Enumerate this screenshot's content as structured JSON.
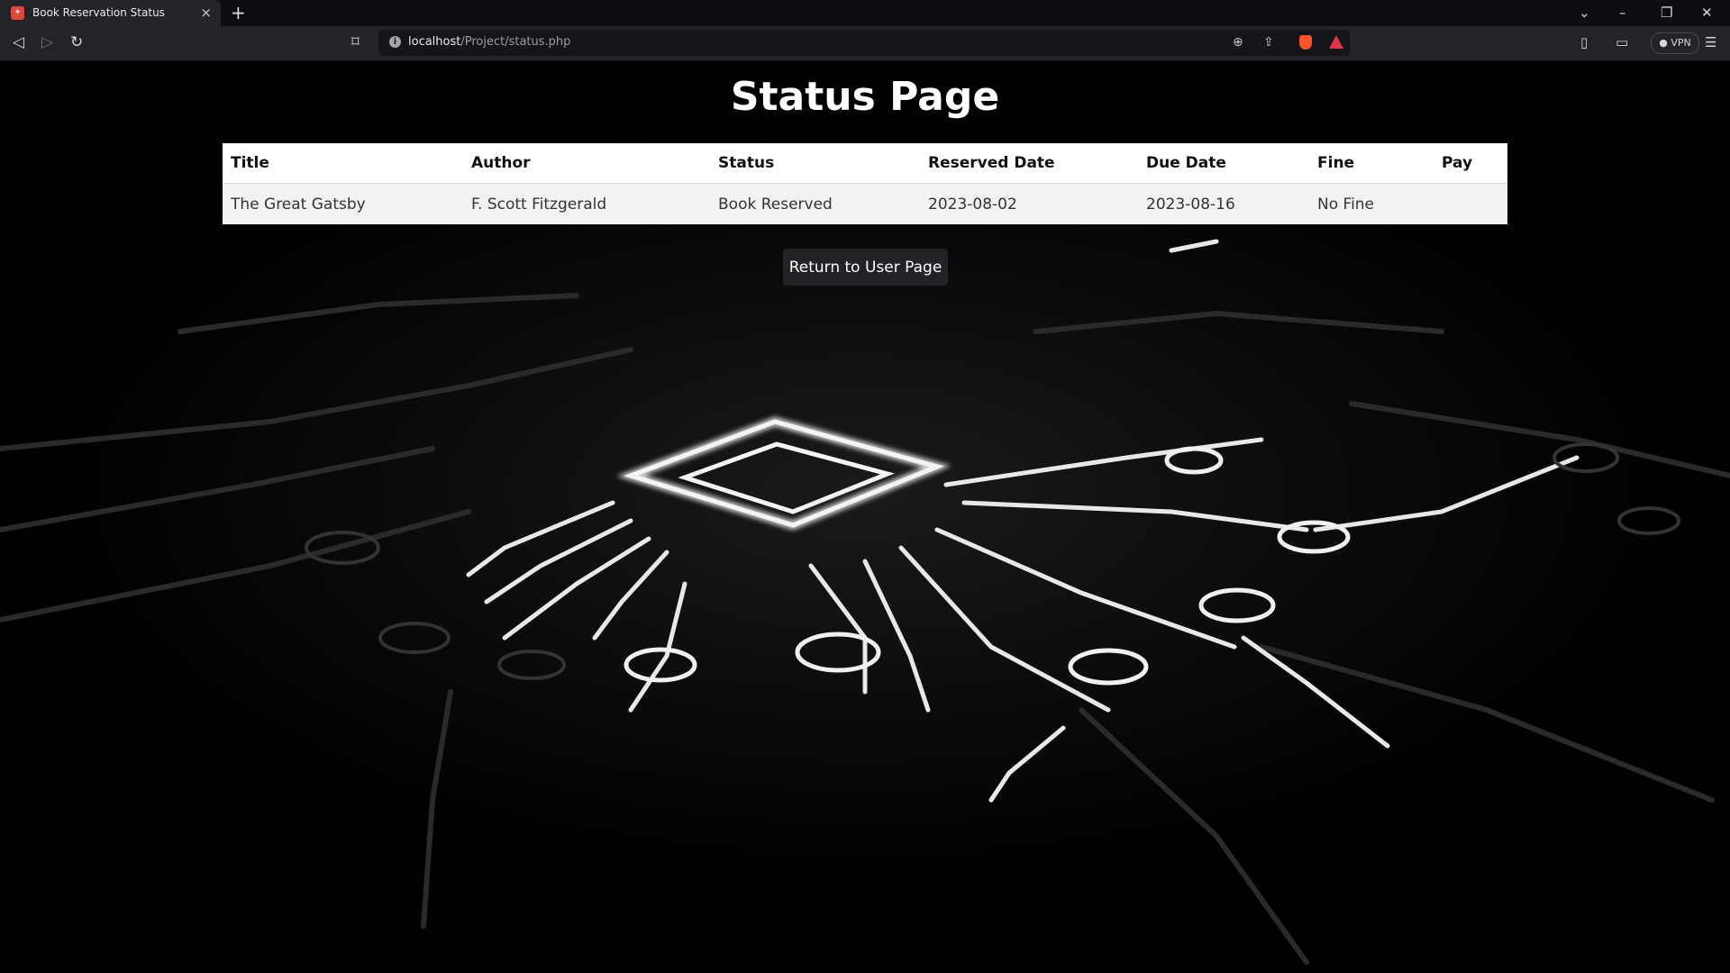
{
  "browser": {
    "tab": {
      "title": "Book Reservation Status",
      "favicon": "xampp-icon"
    },
    "url": {
      "host": "localhost",
      "path": "/Project/status.php"
    },
    "vpn_label": "VPN"
  },
  "page": {
    "title": "Status Page",
    "table": {
      "headers": [
        "Title",
        "Author",
        "Status",
        "Reserved Date",
        "Due Date",
        "Fine",
        "Pay"
      ],
      "rows": [
        [
          "The Great Gatsby",
          "F. Scott Fitzgerald",
          "Book Reserved",
          "2023-08-02",
          "2023-08-16",
          "No Fine",
          ""
        ]
      ]
    },
    "return_button": "Return to User Page"
  },
  "colors": {
    "page_background": "#000000",
    "table_background": "#ffffff",
    "row_background": "#f2f2f2",
    "button_background": "#222326"
  }
}
